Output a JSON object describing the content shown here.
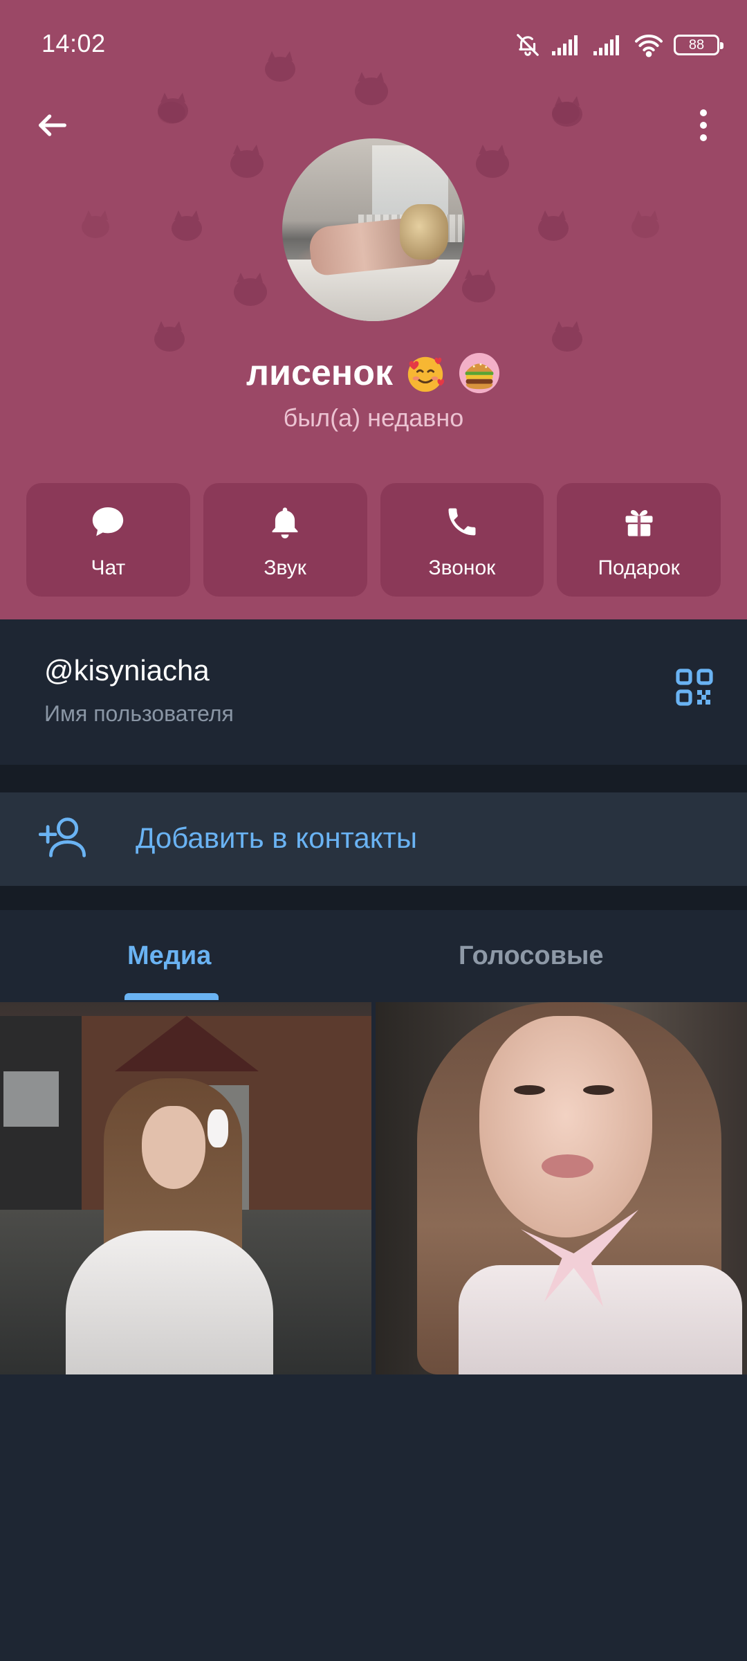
{
  "status_bar": {
    "time": "14:02",
    "battery": "88",
    "icons": [
      "bell-muted-icon",
      "signal-icon",
      "signal-icon",
      "wifi-icon",
      "battery-icon"
    ]
  },
  "header": {
    "background_color": "#9b4866",
    "name": "лисенок",
    "name_emojis": [
      "smiling-face-with-hearts-emoji",
      "burger-emoji"
    ],
    "status": "был(а) недавно"
  },
  "actions": [
    {
      "label": "Чат",
      "icon": "chat-icon"
    },
    {
      "label": "Звук",
      "icon": "bell-icon"
    },
    {
      "label": "Звонок",
      "icon": "phone-icon"
    },
    {
      "label": "Подарок",
      "icon": "gift-icon"
    }
  ],
  "info": {
    "username": "@kisyniacha",
    "username_caption": "Имя пользователя"
  },
  "add_contact": {
    "label": "Добавить в контакты",
    "icon": "add-user-icon"
  },
  "tabs": [
    {
      "label": "Медиа",
      "active": true
    },
    {
      "label": "Голосовые",
      "active": false
    }
  ],
  "colors": {
    "accent": "#6ab3f3",
    "background": "#1e2633",
    "section_divider": "#161c25"
  }
}
